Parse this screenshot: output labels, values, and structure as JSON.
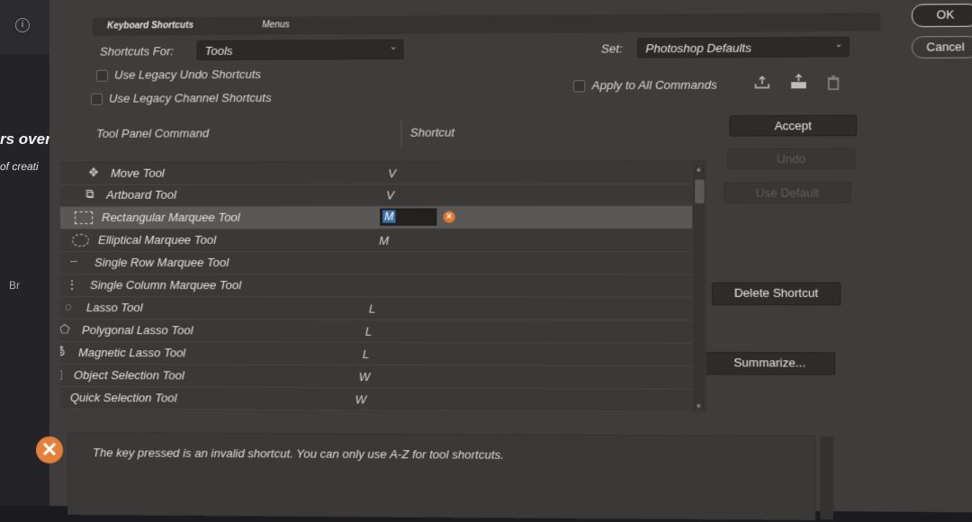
{
  "background": {
    "heading_fragment": "rs over",
    "sub_fragment": "of creati",
    "side_fragment": "Br",
    "info_icon": "info-icon"
  },
  "tabs": {
    "active": "Keyboard Shortcuts",
    "other": "Menus"
  },
  "shortcuts_for": {
    "label": "Shortcuts For:",
    "value": "Tools"
  },
  "set": {
    "label": "Set:",
    "value": "Photoshop Defaults"
  },
  "checkboxes": {
    "legacy_undo": "Use Legacy Undo Shortcuts",
    "legacy_channel": "Use Legacy Channel Shortcuts",
    "apply_all": "Apply to All Commands"
  },
  "columns": {
    "command": "Tool Panel Command",
    "shortcut": "Shortcut"
  },
  "tools": [
    {
      "name": "Move Tool",
      "shortcut": "V",
      "icon": "move-icon"
    },
    {
      "name": "Artboard Tool",
      "shortcut": "V",
      "icon": "artboard-icon"
    },
    {
      "name": "Rectangular Marquee Tool",
      "shortcut": "M",
      "icon": "rect-marquee-icon"
    },
    {
      "name": "Elliptical Marquee Tool",
      "shortcut": "M",
      "icon": "ellipse-marquee-icon"
    },
    {
      "name": "Single Row Marquee Tool",
      "shortcut": "",
      "icon": "row-marquee-icon"
    },
    {
      "name": "Single Column Marquee Tool",
      "shortcut": "",
      "icon": "column-marquee-icon"
    },
    {
      "name": "Lasso Tool",
      "shortcut": "L",
      "icon": "lasso-icon"
    },
    {
      "name": "Polygonal Lasso Tool",
      "shortcut": "L",
      "icon": "polygonal-lasso-icon"
    },
    {
      "name": "Magnetic Lasso Tool",
      "shortcut": "L",
      "icon": "magnetic-lasso-icon"
    },
    {
      "name": "Object Selection Tool",
      "shortcut": "W",
      "icon": "object-selection-icon"
    },
    {
      "name": "Quick Selection Tool",
      "shortcut": "W",
      "icon": "quick-selection-icon"
    }
  ],
  "editing_value": "M",
  "buttons": {
    "ok": "OK",
    "cancel": "Cancel",
    "accept": "Accept",
    "undo": "Undo",
    "use_default": "Use Default",
    "delete_shortcut": "Delete Shortcut",
    "summarize": "Summarize..."
  },
  "message": "The key pressed is an invalid shortcut.  You can only use A-Z for tool shortcuts."
}
